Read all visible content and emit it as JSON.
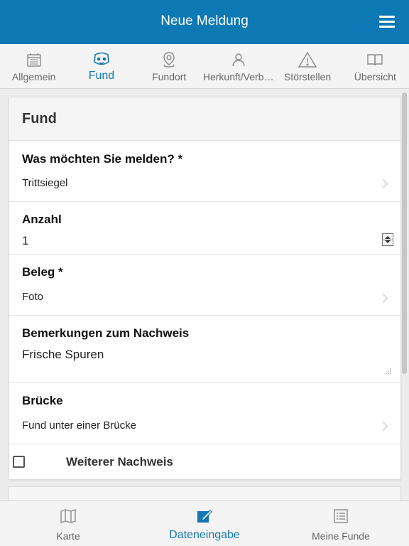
{
  "header": {
    "title": "Neue Meldung",
    "menu_icon": "hamburger-menu-icon"
  },
  "tabs": [
    {
      "label": "Allgemein",
      "icon": "calendar-icon"
    },
    {
      "label": "Fund",
      "icon": "animal-icon"
    },
    {
      "label": "Fundort",
      "icon": "location-pin-icon"
    },
    {
      "label": "Herkunft/Verb…",
      "icon": "person-icon"
    },
    {
      "label": "Störstellen",
      "icon": "warning-icon"
    },
    {
      "label": "Übersicht",
      "icon": "book-icon"
    }
  ],
  "active_tab": "Fund",
  "form": {
    "section_title": "Fund",
    "what": {
      "label": "Was möchten Sie melden? *",
      "value": "Trittsiegel"
    },
    "count": {
      "label": "Anzahl",
      "value": "1"
    },
    "evidence": {
      "label": "Beleg *",
      "value": "Foto"
    },
    "remarks": {
      "label": "Bemerkungen zum Nachweis",
      "value": "Frische Spuren"
    },
    "bridge": {
      "label": "Brücke",
      "value": "Fund unter einer Brücke"
    },
    "more": {
      "label": "Weiterer Nachweis",
      "checked": false
    }
  },
  "bottom_nav": [
    {
      "label": "Karte",
      "icon": "map-icon"
    },
    {
      "label": "Dateneingabe",
      "icon": "edit-icon"
    },
    {
      "label": "Meine Funde",
      "icon": "list-icon"
    }
  ],
  "active_bottom": "Dateneingabe",
  "colors": {
    "primary": "#0c79b5",
    "accent": "#1478b4"
  }
}
